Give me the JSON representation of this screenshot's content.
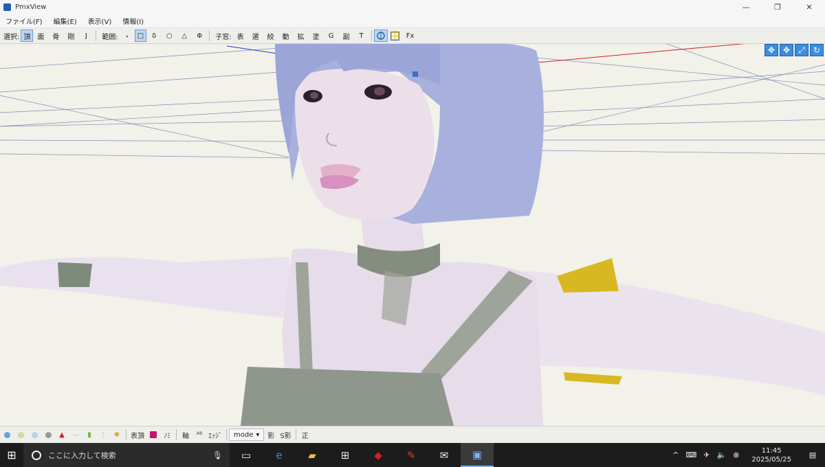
{
  "window": {
    "title": "PmxView",
    "minimize": "—",
    "maximize": "❐",
    "close": "✕"
  },
  "menu": [
    "ファイル(F)",
    "編集(E)",
    "表示(V)",
    "情報(I)"
  ],
  "toolbar": {
    "select_label": "選択:",
    "select_items": [
      "頂",
      "面",
      "骨",
      "剛",
      "J"
    ],
    "range_label": "範囲:",
    "range_items": [
      "・",
      "□",
      "δ",
      "○",
      "△",
      "Φ"
    ],
    "child_label": "子窓:",
    "child_items": [
      "表",
      "選",
      "絞",
      "動",
      "拡",
      "塗",
      "G",
      "副",
      "T"
    ],
    "fx_label": "Fx"
  },
  "view_tools": [
    "✥",
    "✥",
    "⤢",
    "↻"
  ],
  "bottom": {
    "vertex_label": "表頂",
    "norm_label": "ﾉﾐ",
    "axis_label": "軸",
    "ab_label": "ᴬᴮ",
    "edge_label": "ｴｯｼﾞ",
    "mode_label": "mode",
    "shadow_label": "影",
    "sshadow_label": "S影",
    "ortho_label": "正"
  },
  "taskbar": {
    "search_placeholder": "ここに入力して検索",
    "time": "11:45",
    "date": "2025/05/25"
  },
  "colors": {
    "accent": "#3a8ee0",
    "taskbar": "#1c1c1c",
    "skin": "#ece4f0",
    "hair": "#9aa3d8",
    "strap": "#9ea49a"
  }
}
